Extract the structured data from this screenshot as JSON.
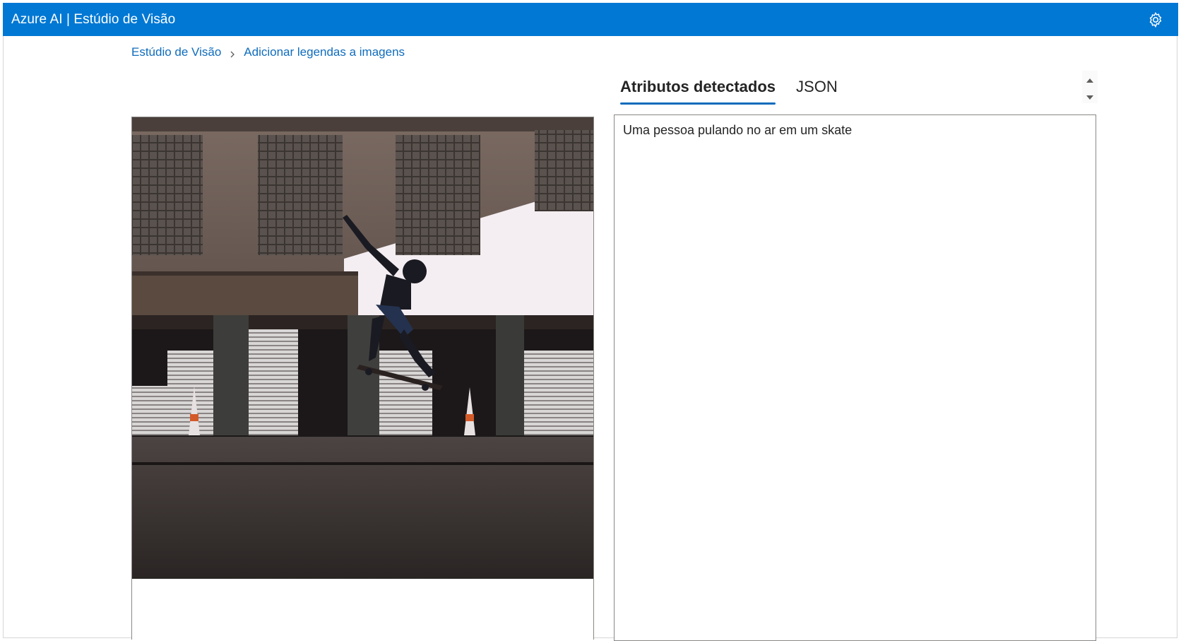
{
  "app": {
    "title": "Azure AI | Estúdio de Visão",
    "header_color": "#0078d4",
    "settings_icon": "gear-icon"
  },
  "breadcrumb": {
    "items": [
      "Estúdio de Visão",
      "Adicionar legendas a imagens"
    ],
    "separator_icon": "chevron-right-icon"
  },
  "image": {
    "alt": "skateboarder photo"
  },
  "tabs": [
    {
      "label": "Atributos detectados",
      "active": true
    },
    {
      "label": "JSON",
      "active": false
    }
  ],
  "result": {
    "caption": "Uma pessoa pulando no ar em um skate"
  }
}
